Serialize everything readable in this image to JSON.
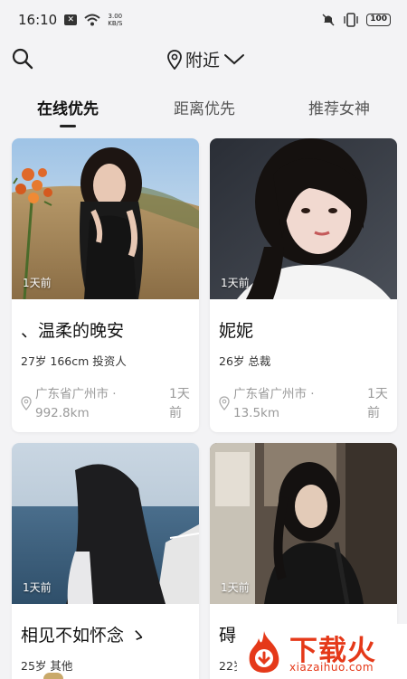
{
  "status_bar": {
    "time": "16:10",
    "speed_value": "3.00",
    "speed_unit": "KB/S",
    "battery": "100"
  },
  "header": {
    "location_label": "附近"
  },
  "tabs": [
    {
      "label": "在线优先",
      "active": true
    },
    {
      "label": "距离优先",
      "active": false
    },
    {
      "label": "推荐女神",
      "active": false
    }
  ],
  "cards": [
    {
      "time": "1天前",
      "name": "、温柔的晚安",
      "info": "27岁  166cm  投资人",
      "location": "广东省广州市 · 992.8km",
      "active": "1天前"
    },
    {
      "time": "1天前",
      "name": "妮妮",
      "info": "26岁  总裁",
      "location": "广东省广州市 · 13.5km",
      "active": "1天前"
    },
    {
      "time": "1天前",
      "name": "相见不如怀念 ゝ",
      "info": "25岁  其他"
    },
    {
      "time": "1天前",
      "name": "碍",
      "info": "22岁"
    }
  ],
  "watermark": {
    "title": "下载火",
    "subtitle": "xiazaihuo.com"
  }
}
